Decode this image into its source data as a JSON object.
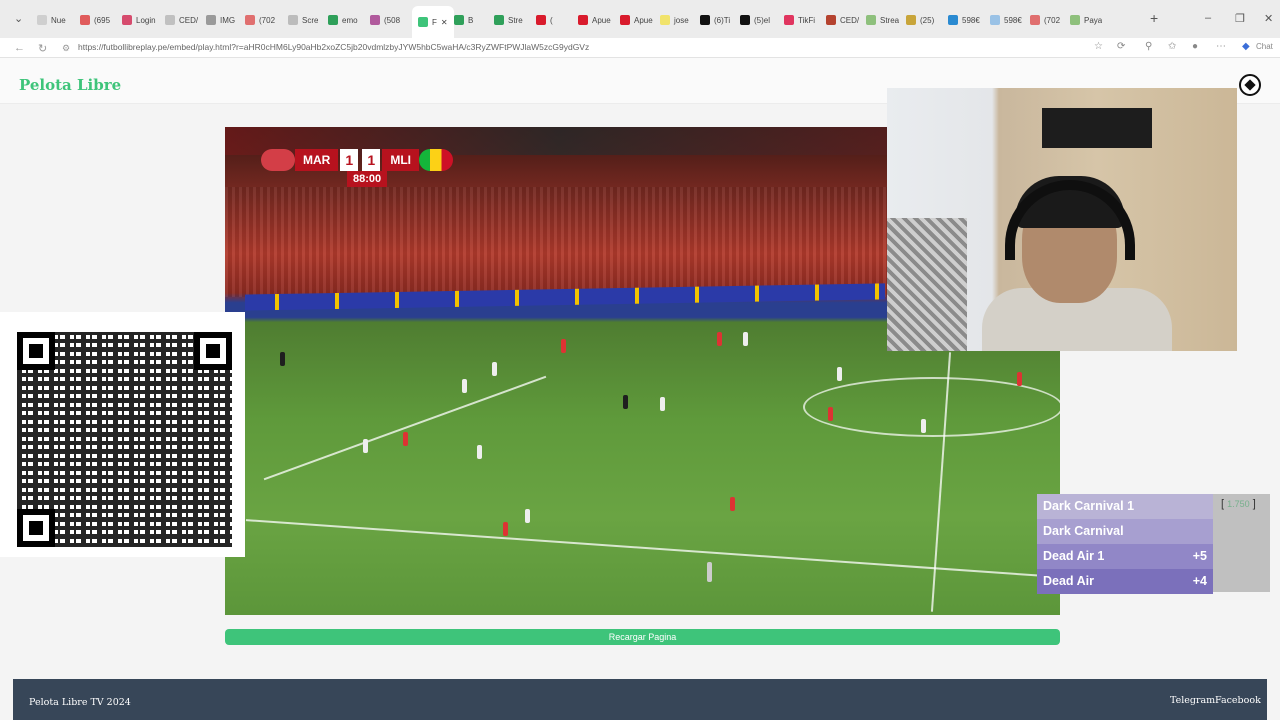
{
  "browser": {
    "tabs": [
      {
        "label": "Nue",
        "color": "#cfcfcf"
      },
      {
        "label": "(695",
        "color": "#e05b5b"
      },
      {
        "label": "Login",
        "color": "#d64b6d"
      },
      {
        "label": "CED/",
        "color": "#c0c0c0"
      },
      {
        "label": "IMG",
        "color": "#9a9a9a"
      },
      {
        "label": "(702",
        "color": "#e06f6f"
      },
      {
        "label": "Scre",
        "color": "#bcbcbc"
      },
      {
        "label": "emo",
        "color": "#2fa05a"
      },
      {
        "label": "(508",
        "color": "#b05a9c"
      },
      {
        "label": "F",
        "color": "#3ec47a"
      },
      {
        "label": "B",
        "color": "#2fa05a"
      },
      {
        "label": "Stre",
        "color": "#2fa05a"
      },
      {
        "label": "(",
        "color": "#d91b2c"
      },
      {
        "label": "Apue",
        "color": "#d91b2c"
      },
      {
        "label": "Apue",
        "color": "#d91b2c"
      },
      {
        "label": "jose",
        "color": "#f1e36b"
      },
      {
        "label": "(6)Ti",
        "color": "#111111"
      },
      {
        "label": "(5)el",
        "color": "#111111"
      },
      {
        "label": "TikFi",
        "color": "#e0355f"
      },
      {
        "label": "CED/",
        "color": "#b5432f"
      },
      {
        "label": "Strea",
        "color": "#8ec07c"
      },
      {
        "label": "(25)",
        "color": "#c8a53a"
      },
      {
        "label": "598€",
        "color": "#2a8ad1"
      },
      {
        "label": "598€",
        "color": "#9ac2e6"
      },
      {
        "label": "(702",
        "color": "#e06f6f"
      },
      {
        "label": "Paya",
        "color": "#8ec07c"
      }
    ],
    "url": "https://futbollibreplay.pe/embed/play.html?r=aHR0cHM6Ly90aHb2xoZC5jb20vdmlzbyJYW5hbC5waHA/c3RyZWFtPWJlaW5zcG9ydGVz",
    "chat_label": "Chat"
  },
  "site": {
    "brand": "Pelota Libre",
    "reload_label": "Recargar Pagina",
    "footer": {
      "copyright": "Pelota Libre TV 2024",
      "links": [
        "Telegram",
        "Facebook"
      ]
    }
  },
  "scoreboard": {
    "home": "MAR",
    "home_score": "1",
    "away_score": "1",
    "away": "MLI",
    "clock": "88:00"
  },
  "leaderboard": {
    "tag": "1.750",
    "rows": [
      {
        "name": "Dark Carnival 1",
        "points": "",
        "color": "#b9b3d6"
      },
      {
        "name": "Dark Carnival",
        "points": "",
        "color": "#a79fd0"
      },
      {
        "name": "Dead Air 1",
        "points": "+5",
        "color": "#9187c7"
      },
      {
        "name": "Dead Air",
        "points": "+4",
        "color": "#7b70bb"
      }
    ]
  }
}
